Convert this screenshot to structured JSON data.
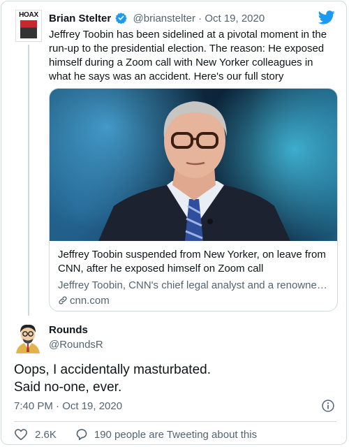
{
  "quoted_tweet": {
    "avatar_text": "HOAX",
    "name": "Brian Stelter",
    "handle": "@brianstelter",
    "date": "· Oct 19, 2020",
    "text": "Jeffrey Toobin has been sidelined at a pivotal moment in the run-up to the presidential election. The reason: He exposed himself during a Zoom call with New Yorker colleagues in what he says was an accident. Here's our full story",
    "link_card": {
      "title": "Jeffrey Toobin suspended from New Yorker, on leave from CNN, after he exposed himself on Zoom call",
      "description": "Jeffrey Toobin, CNN's chief legal analyst and a renowned r...",
      "domain": "cnn.com"
    }
  },
  "tweet": {
    "name": "Rounds",
    "handle": "@RoundsR",
    "text_line1": "Oops, I accidentally masturbated.",
    "text_line2": "Said no-one, ever.",
    "timestamp": "7:40 PM · Oct 19, 2020",
    "like_count": "2.6K",
    "reply_text": "190 people are Tweeting about this"
  },
  "icons": {
    "verified": "verified-badge-icon",
    "brand": "twitter-bird-icon",
    "link": "link-icon",
    "info": "info-icon",
    "like": "heart-icon",
    "reply": "reply-bubble-icon"
  },
  "colors": {
    "twitter_blue": "#1d9bf0",
    "secondary_text": "#536471",
    "border": "#cfd9de"
  }
}
